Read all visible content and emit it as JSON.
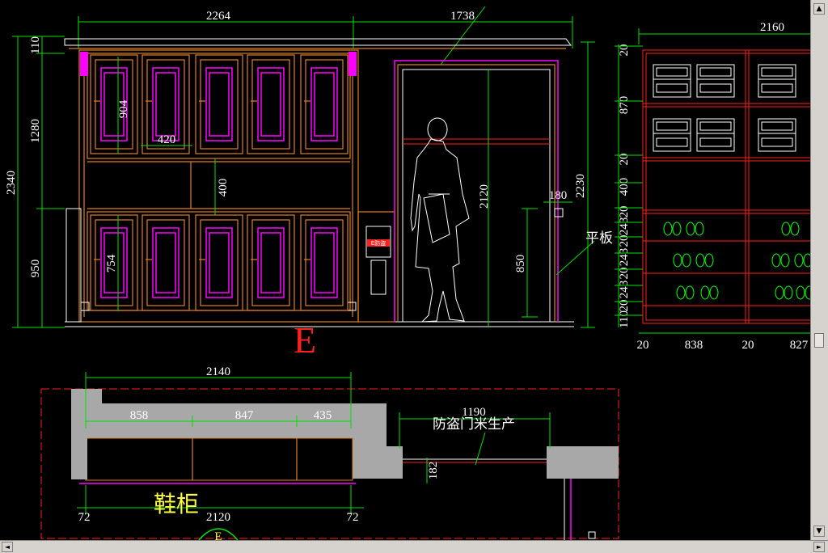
{
  "colors": {
    "background": "#000000",
    "dimension": "#00e000",
    "cabinet": "#e08020",
    "ornament": "#ff00ff",
    "wall": "#ff2020",
    "text": "#ffffff",
    "label_red": "#ff2020",
    "label_yellow": "#ffff40",
    "fill_gray": "#a0a0a0"
  },
  "elevation": {
    "label": "E",
    "top_dims": {
      "cabinet_width": "2264",
      "door_width": "1738"
    },
    "left_dims": {
      "top_trim": "110",
      "upper": "1280",
      "total": "2340",
      "lower": "950"
    },
    "inner_dims": {
      "upper_door_height": "904",
      "upper_door_width": "420",
      "niche": "400",
      "lower_door_height": "754"
    },
    "door_dims": {
      "door_height": "2120",
      "handle_height": "850",
      "frame": "180",
      "wall_height": "2230"
    },
    "note": "平板",
    "lock_label": "E防盗"
  },
  "side_section": {
    "top_dim": "2160",
    "left_dims": [
      "20",
      "870",
      "20",
      "400",
      "20",
      "243",
      "20",
      "243",
      "20",
      "243",
      "20",
      "110"
    ],
    "bottom_dims": [
      "20",
      "838",
      "20",
      "827"
    ]
  },
  "plan": {
    "label": "鞋柜",
    "door_note": "防盗门米生产",
    "top_dim": "2140",
    "segments": [
      "858",
      "847",
      "435"
    ],
    "door_dim": "1190",
    "depth": "182",
    "bottom_dims": {
      "left": "72",
      "center": "2120",
      "right": "72"
    },
    "section_mark": "E"
  },
  "scrollbars": {
    "up": "▲",
    "down": "▼",
    "left": "◄",
    "right": "►"
  }
}
